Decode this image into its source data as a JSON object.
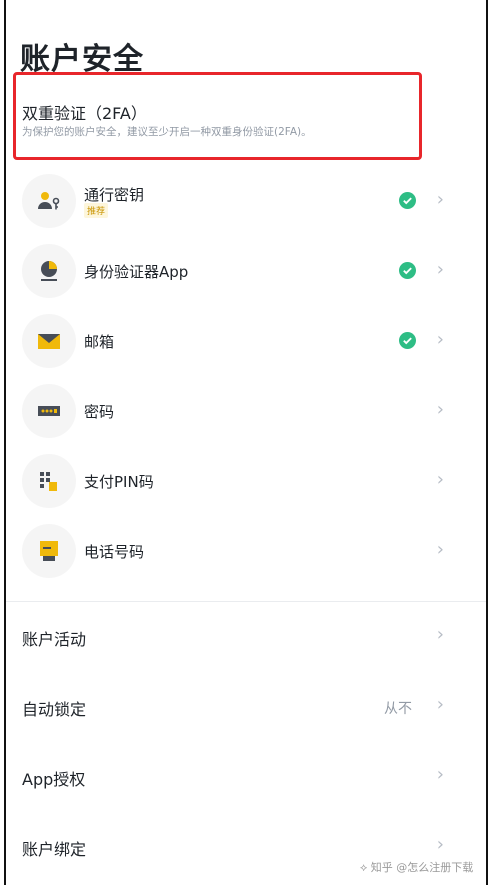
{
  "page": {
    "title": "账户安全"
  },
  "twofa": {
    "title": "双重验证（2FA）",
    "description": "为保护您的账户安全，建议至少开启一种双重身份验证(2FA)。"
  },
  "methods": [
    {
      "label": "通行密钥",
      "badge": "推荐",
      "icon": "passkey-icon",
      "enabled": true
    },
    {
      "label": "身份验证器App",
      "icon": "authenticator-icon",
      "enabled": true
    },
    {
      "label": "邮箱",
      "icon": "mail-icon",
      "enabled": true
    },
    {
      "label": "密码",
      "icon": "password-icon",
      "enabled": false
    },
    {
      "label": "支付PIN码",
      "icon": "pin-icon",
      "enabled": false
    },
    {
      "label": "电话号码",
      "icon": "phone-icon",
      "enabled": false
    }
  ],
  "settings": [
    {
      "label": "账户活动",
      "value": ""
    },
    {
      "label": "自动锁定",
      "value": "从不"
    },
    {
      "label": "App授权",
      "value": ""
    },
    {
      "label": "账户绑定",
      "value": ""
    }
  ],
  "watermark": "⟡ 知乎 @怎么注册下载",
  "colors": {
    "accent": "#f0b90b",
    "highlight_border": "#e8262b",
    "check": "#2ebd85"
  }
}
